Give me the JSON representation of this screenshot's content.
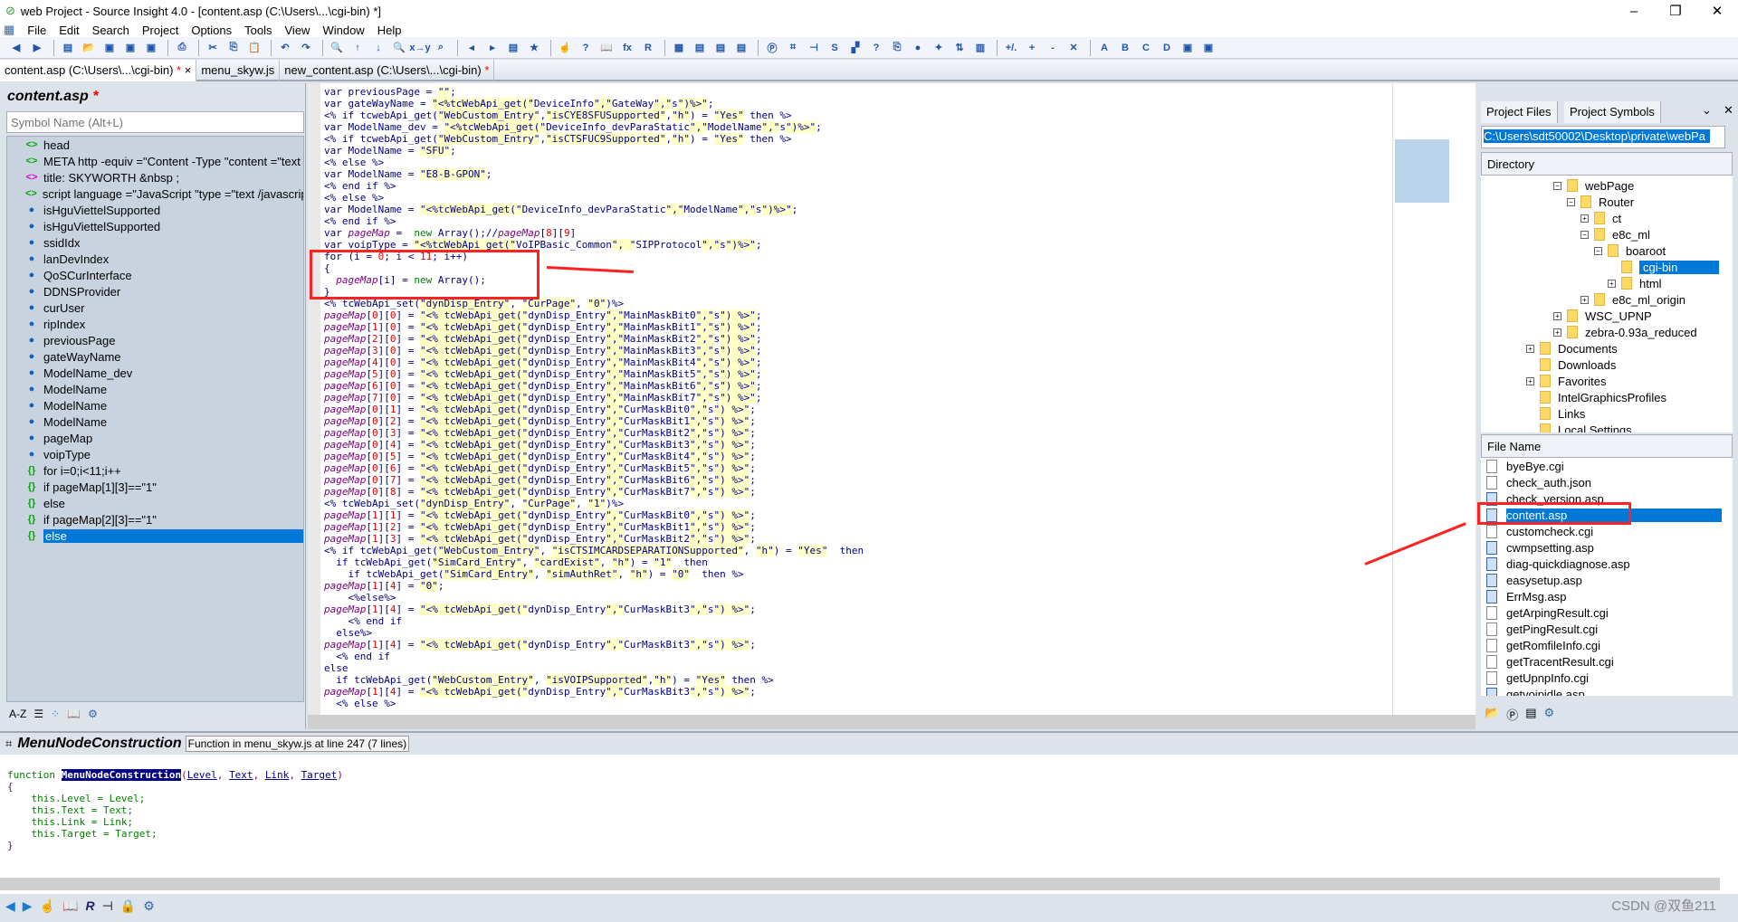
{
  "window": {
    "title": "web Project - Source Insight 4.0 - [content.asp (C:\\Users\\...\\cgi-bin) *]",
    "controls": [
      "–",
      "❐",
      "✕"
    ]
  },
  "menu": [
    "File",
    "Edit",
    "Search",
    "Project",
    "Options",
    "Tools",
    "View",
    "Window",
    "Help"
  ],
  "tabs": [
    {
      "label": "content.asp (C:\\Users\\...\\cgi-bin)",
      "modified": "*",
      "close": "×"
    },
    {
      "label": "menu_skyw.js",
      "modified": ""
    },
    {
      "label": "new_content.asp (C:\\Users\\...\\cgi-bin)",
      "modified": "*"
    }
  ],
  "symbol_window": {
    "title": "content.asp",
    "modified": "*",
    "search_placeholder": "Symbol Name (Alt+L)",
    "items": [
      {
        "label": "head",
        "type": "tag"
      },
      {
        "label": "META http -equiv =\"Content -Type \"content =\"text",
        "type": "tag"
      },
      {
        "label": "title: SKYWORTH &nbsp ;",
        "type": "title"
      },
      {
        "label": "script language =\"JavaScript \"type =\"text /javascrip",
        "type": "tag"
      },
      {
        "label": "isHguViettelSupported",
        "type": "var"
      },
      {
        "label": "isHguViettelSupported",
        "type": "var"
      },
      {
        "label": "ssidIdx",
        "type": "var"
      },
      {
        "label": "lanDevIndex",
        "type": "var"
      },
      {
        "label": "QoSCurInterface",
        "type": "var"
      },
      {
        "label": "DDNSProvider",
        "type": "var"
      },
      {
        "label": "curUser",
        "type": "var"
      },
      {
        "label": "ripIndex",
        "type": "var"
      },
      {
        "label": "previousPage",
        "type": "var"
      },
      {
        "label": "gateWayName",
        "type": "var"
      },
      {
        "label": "ModelName_dev",
        "type": "var"
      },
      {
        "label": "ModelName",
        "type": "var"
      },
      {
        "label": "ModelName",
        "type": "var"
      },
      {
        "label": "ModelName",
        "type": "var"
      },
      {
        "label": "pageMap",
        "type": "var"
      },
      {
        "label": "voipType",
        "type": "var"
      },
      {
        "label": "for i=0;i<11;i++",
        "type": "block"
      },
      {
        "label": "if pageMap[1][3]==\"1\"",
        "type": "block"
      },
      {
        "label": "else",
        "type": "block"
      },
      {
        "label": "if pageMap[2][3]==\"1\"",
        "type": "block"
      },
      {
        "label": "else",
        "type": "block",
        "selected": true
      }
    ],
    "tools": [
      "A-Z",
      "list-icon",
      "categories-icon",
      "book-icon",
      "gear-icon"
    ]
  },
  "editor": {
    "lines": [
      "var previousPage = \"\";",
      "var gateWayName = \"<%tcWebApi_get(\"DeviceInfo\",\"GateWay\",\"s\")%>\";",
      "<% if tcwebApi_get(\"WebCustom_Entry\",\"isCYE8SFUSupported\",\"h\") = \"Yes\" then %>",
      "var ModelName_dev = \"<%tcWebApi_get(\"DeviceInfo_devParaStatic\",\"ModelName\",\"s\")%>\";",
      "<% if tcwebApi_get(\"WebCustom_Entry\",\"isCTSFUC9Supported\",\"h\") = \"Yes\" then %>",
      "var ModelName = \"SFU\";",
      "<% else %>",
      "var ModelName = \"E8-B-GPON\";",
      "<% end if %>",
      "<% else %>",
      "var ModelName = \"<%tcWebApi_get(\"DeviceInfo_devParaStatic\",\"ModelName\",\"s\")%>\";",
      "<% end if %>",
      "var pageMap =  new Array();//pageMap[8][9]",
      "var voipType = \"<%tcWebApi_get(\"VoIPBasic_Common\", \"SIPProtocol\",\"s\")%>\";",
      "for (i = 0; i < 11; i++)",
      "{",
      "  pageMap[i] = new Array();",
      "}",
      "<% tcWebApi_set(\"dynDisp_Entry\", \"CurPage\", \"0\")%>",
      "pageMap[0][0] = \"<% tcWebApi_get(\"dynDisp_Entry\",\"MainMaskBit0\",\"s\") %>\";",
      "pageMap[1][0] = \"<% tcWebApi_get(\"dynDisp_Entry\",\"MainMaskBit1\",\"s\") %>\";",
      "pageMap[2][0] = \"<% tcWebApi_get(\"dynDisp_Entry\",\"MainMaskBit2\",\"s\") %>\";",
      "pageMap[3][0] = \"<% tcWebApi_get(\"dynDisp_Entry\",\"MainMaskBit3\",\"s\") %>\";",
      "pageMap[4][0] = \"<% tcWebApi_get(\"dynDisp_Entry\",\"MainMaskBit4\",\"s\") %>\";",
      "pageMap[5][0] = \"<% tcWebApi_get(\"dynDisp_Entry\",\"MainMaskBit5\",\"s\") %>\";",
      "pageMap[6][0] = \"<% tcWebApi_get(\"dynDisp_Entry\",\"MainMaskBit6\",\"s\") %>\";",
      "pageMap[7][0] = \"<% tcWebApi_get(\"dynDisp_Entry\",\"MainMaskBit7\",\"s\") %>\";",
      "pageMap[0][1] = \"<% tcWebApi_get(\"dynDisp_Entry\",\"CurMaskBit0\",\"s\") %>\";",
      "pageMap[0][2] = \"<% tcWebApi_get(\"dynDisp_Entry\",\"CurMaskBit1\",\"s\") %>\";",
      "pageMap[0][3] = \"<% tcWebApi_get(\"dynDisp_Entry\",\"CurMaskBit2\",\"s\") %>\";",
      "pageMap[0][4] = \"<% tcWebApi_get(\"dynDisp_Entry\",\"CurMaskBit3\",\"s\") %>\";",
      "pageMap[0][5] = \"<% tcWebApi_get(\"dynDisp_Entry\",\"CurMaskBit4\",\"s\") %>\";",
      "pageMap[0][6] = \"<% tcWebApi_get(\"dynDisp_Entry\",\"CurMaskBit5\",\"s\") %>\";",
      "pageMap[0][7] = \"<% tcWebApi_get(\"dynDisp_Entry\",\"CurMaskBit6\",\"s\") %>\";",
      "pageMap[0][8] = \"<% tcWebApi_get(\"dynDisp_Entry\",\"CurMaskBit7\",\"s\") %>\";",
      "<% tcWebApi_set(\"dynDisp_Entry\", \"CurPage\", \"1\")%>",
      "pageMap[1][1] = \"<% tcWebApi_get(\"dynDisp_Entry\",\"CurMaskBit0\",\"s\") %>\";",
      "pageMap[1][2] = \"<% tcWebApi_get(\"dynDisp_Entry\",\"CurMaskBit1\",\"s\") %>\";",
      "pageMap[1][3] = \"<% tcWebApi_get(\"dynDisp_Entry\",\"CurMaskBit2\",\"s\") %>\";",
      "<% if tcWebApi_get(\"WebCustom_Entry\", \"isCTSIMCARDSEPARATIONSupported\", \"h\") = \"Yes\"  then",
      "  if tcWebApi_get(\"SimCard_Entry\", \"cardExist\", \"h\") = \"1\"  then",
      "    if tcWebApi_get(\"SimCard_Entry\", \"simAuthRet\", \"h\") = \"0\"  then %>",
      "pageMap[1][4] = \"0\";",
      "    <%else%>",
      "pageMap[1][4] = \"<% tcWebApi_get(\"dynDisp_Entry\",\"CurMaskBit3\",\"s\") %>\";",
      "    <% end if",
      "  else%>",
      "pageMap[1][4] = \"<% tcWebApi_get(\"dynDisp_Entry\",\"CurMaskBit3\",\"s\") %>\";",
      "  <% end if",
      "else",
      "  if tcWebApi_get(\"WebCustom_Entry\", \"isVOIPSupported\",\"h\") = \"Yes\" then %>",
      "pageMap[1][4] = \"<% tcWebApi_get(\"dynDisp_Entry\",\"CurMaskBit3\",\"s\") %>\";",
      "  <% else %>"
    ]
  },
  "project_window": {
    "tabs": [
      "Project Files",
      "Project Symbols"
    ],
    "path": "C:\\Users\\sdt50002\\Desktop\\private\\webPa",
    "directory_header": "Directory",
    "file_header": "File Name",
    "dirs": [
      {
        "label": "webPage",
        "depth": 2,
        "toggle": "−"
      },
      {
        "label": "Router",
        "depth": 3,
        "toggle": "−"
      },
      {
        "label": "ct",
        "depth": 4,
        "toggle": "+"
      },
      {
        "label": "e8c_ml",
        "depth": 4,
        "toggle": "−"
      },
      {
        "label": "boaroot",
        "depth": 5,
        "toggle": "−"
      },
      {
        "label": "cgi-bin",
        "depth": 6,
        "toggle": "",
        "selected": true
      },
      {
        "label": "html",
        "depth": 6,
        "toggle": "+"
      },
      {
        "label": "e8c_ml_origin",
        "depth": 4,
        "toggle": "+"
      },
      {
        "label": "WSC_UPNP",
        "depth": 2,
        "toggle": "+"
      },
      {
        "label": "zebra-0.93a_reduced",
        "depth": 2,
        "toggle": "+"
      },
      {
        "label": "Documents",
        "depth": 0,
        "toggle": "+"
      },
      {
        "label": "Downloads",
        "depth": 0,
        "toggle": ""
      },
      {
        "label": "Favorites",
        "depth": 0,
        "toggle": "+"
      },
      {
        "label": "IntelGraphicsProfiles",
        "depth": 0,
        "toggle": ""
      },
      {
        "label": "Links",
        "depth": 0,
        "toggle": ""
      },
      {
        "label": "Local Settings",
        "depth": 0,
        "toggle": ""
      }
    ],
    "files": [
      {
        "name": "byeBye.cgi",
        "type": "cgi"
      },
      {
        "name": "check_auth.json",
        "type": "cgi"
      },
      {
        "name": "check_version.asp",
        "type": "asp"
      },
      {
        "name": "content.asp",
        "type": "asp",
        "selected": true
      },
      {
        "name": "customcheck.cgi",
        "type": "cgi"
      },
      {
        "name": "cwmpsetting.asp",
        "type": "asp"
      },
      {
        "name": "diag-quickdiagnose.asp",
        "type": "asp"
      },
      {
        "name": "easysetup.asp",
        "type": "asp"
      },
      {
        "name": "ErrMsg.asp",
        "type": "asp"
      },
      {
        "name": "getArpingResult.cgi",
        "type": "cgi"
      },
      {
        "name": "getPingResult.cgi",
        "type": "cgi"
      },
      {
        "name": "getRomfileInfo.cgi",
        "type": "cgi"
      },
      {
        "name": "getTracentResult.cgi",
        "type": "cgi"
      },
      {
        "name": "getUpnpInfo.cgi",
        "type": "cgi"
      },
      {
        "name": "getvoipidle.asp",
        "type": "asp"
      }
    ]
  },
  "context_window": {
    "symbol": "MenuNodeConstruction",
    "info": "Function in menu_skyw.js at line 247 (7 lines)",
    "code": {
      "kw": "function",
      "name": "MenuNodeConstruction",
      "params": [
        "Level",
        "Text",
        "Link",
        "Target"
      ],
      "open": "{",
      "body": [
        "this.Level = Level;",
        "this.Text = Text;",
        "this.Link = Link;",
        "this.Target = Target;"
      ],
      "close": "}"
    }
  },
  "watermark": "CSDN @双鱼211",
  "colors": {
    "selection": "#0078d7",
    "annotation": "#ff2222",
    "string_bg": "#ffffc8"
  }
}
